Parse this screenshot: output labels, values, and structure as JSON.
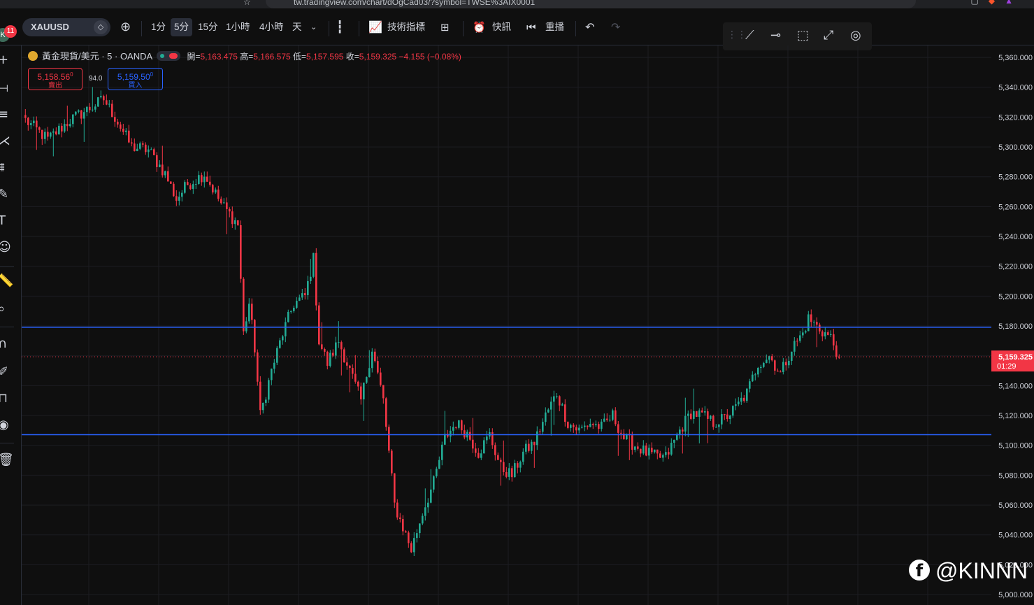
{
  "browser": {
    "url": "tw.tradingview.com/chart/dOgCad03/?symbol=TWSE%3AIX0001"
  },
  "toolbar": {
    "notification_count": "11",
    "symbol": "XAUUSD",
    "timeframes": [
      "1分",
      "5分",
      "15分",
      "1小時",
      "4小時",
      "天"
    ],
    "active_timeframe": "5分",
    "indicators_label": "技術指標",
    "news_label": "快訊",
    "replay_label": "重播"
  },
  "legend": {
    "title": "黃金現貨/美元 · 5 · OANDA",
    "open_label": "開=",
    "open": "5,163.475",
    "high_label": "高=",
    "high": "5,166.575",
    "low_label": "低=",
    "low": "5,157.595",
    "close_label": "收=",
    "close": "5,159.325",
    "change": "−4.155 (−0.08%)"
  },
  "trade": {
    "sell_price": "5,158.56",
    "sell_sup": "0",
    "sell_label": "賣出",
    "spread": "94.0",
    "buy_price": "5,159.50",
    "buy_sup": "0",
    "buy_label": "買入"
  },
  "colors": {
    "up": "#22ab94",
    "down": "#f23645",
    "hline": "#2962ff",
    "background": "#0f0f0f"
  },
  "chart_data": {
    "type": "candlestick",
    "symbol": "XAUUSD",
    "interval": "5",
    "ylim": [
      4993,
      5368
    ],
    "y_ticks": [
      5000,
      5020,
      5040,
      5060,
      5080,
      5100,
      5120,
      5140,
      5160,
      5180,
      5200,
      5220,
      5240,
      5260,
      5280,
      5300,
      5320,
      5340,
      5360
    ],
    "horizontal_lines": [
      {
        "value": 5179.16,
        "label": "5,179.160"
      },
      {
        "value": 5107.15,
        "label": "5,107.150"
      }
    ],
    "last_price": {
      "value": 5159.325,
      "label": "5,159.325",
      "countdown": "01:29"
    },
    "close_path": [
      {
        "i": 0,
        "p": 5318
      },
      {
        "i": 8,
        "p": 5305
      },
      {
        "i": 16,
        "p": 5318
      },
      {
        "i": 24,
        "p": 5327
      },
      {
        "i": 28,
        "p": 5332
      },
      {
        "i": 32,
        "p": 5320
      },
      {
        "i": 38,
        "p": 5300
      },
      {
        "i": 44,
        "p": 5298
      },
      {
        "i": 50,
        "p": 5282
      },
      {
        "i": 54,
        "p": 5265
      },
      {
        "i": 58,
        "p": 5275
      },
      {
        "i": 64,
        "p": 5282
      },
      {
        "i": 70,
        "p": 5262
      },
      {
        "i": 76,
        "p": 5248
      },
      {
        "i": 78,
        "p": 5175
      },
      {
        "i": 80,
        "p": 5195
      },
      {
        "i": 82,
        "p": 5165
      },
      {
        "i": 84,
        "p": 5120
      },
      {
        "i": 88,
        "p": 5150
      },
      {
        "i": 92,
        "p": 5175
      },
      {
        "i": 96,
        "p": 5195
      },
      {
        "i": 100,
        "p": 5200
      },
      {
        "i": 103,
        "p": 5225
      },
      {
        "i": 105,
        "p": 5170
      },
      {
        "i": 108,
        "p": 5155
      },
      {
        "i": 112,
        "p": 5170
      },
      {
        "i": 116,
        "p": 5150
      },
      {
        "i": 120,
        "p": 5130
      },
      {
        "i": 124,
        "p": 5165
      },
      {
        "i": 128,
        "p": 5130
      },
      {
        "i": 132,
        "p": 5060
      },
      {
        "i": 136,
        "p": 5040
      },
      {
        "i": 138,
        "p": 5030
      },
      {
        "i": 142,
        "p": 5055
      },
      {
        "i": 146,
        "p": 5075
      },
      {
        "i": 150,
        "p": 5105
      },
      {
        "i": 154,
        "p": 5115
      },
      {
        "i": 158,
        "p": 5108
      },
      {
        "i": 162,
        "p": 5095
      },
      {
        "i": 166,
        "p": 5107
      },
      {
        "i": 170,
        "p": 5085
      },
      {
        "i": 174,
        "p": 5080
      },
      {
        "i": 178,
        "p": 5095
      },
      {
        "i": 182,
        "p": 5102
      },
      {
        "i": 186,
        "p": 5120
      },
      {
        "i": 190,
        "p": 5135
      },
      {
        "i": 194,
        "p": 5115
      },
      {
        "i": 198,
        "p": 5110
      },
      {
        "i": 202,
        "p": 5115
      },
      {
        "i": 206,
        "p": 5112
      },
      {
        "i": 210,
        "p": 5120
      },
      {
        "i": 214,
        "p": 5105
      },
      {
        "i": 218,
        "p": 5100
      },
      {
        "i": 222,
        "p": 5095
      },
      {
        "i": 226,
        "p": 5092
      },
      {
        "i": 229,
        "p": 5092
      },
      {
        "i": 234,
        "p": 5110
      },
      {
        "i": 238,
        "p": 5122
      },
      {
        "i": 242,
        "p": 5120
      },
      {
        "i": 246,
        "p": 5115
      },
      {
        "i": 250,
        "p": 5118
      },
      {
        "i": 254,
        "p": 5125
      },
      {
        "i": 258,
        "p": 5135
      },
      {
        "i": 262,
        "p": 5155
      },
      {
        "i": 266,
        "p": 5160
      },
      {
        "i": 270,
        "p": 5148
      },
      {
        "i": 274,
        "p": 5165
      },
      {
        "i": 278,
        "p": 5175
      },
      {
        "i": 280,
        "p": 5185
      },
      {
        "i": 284,
        "p": 5178
      },
      {
        "i": 288,
        "p": 5172
      },
      {
        "i": 291,
        "p": 5159
      }
    ]
  },
  "watermark": {
    "icon": "facebook-icon",
    "text": "@KINNN"
  }
}
